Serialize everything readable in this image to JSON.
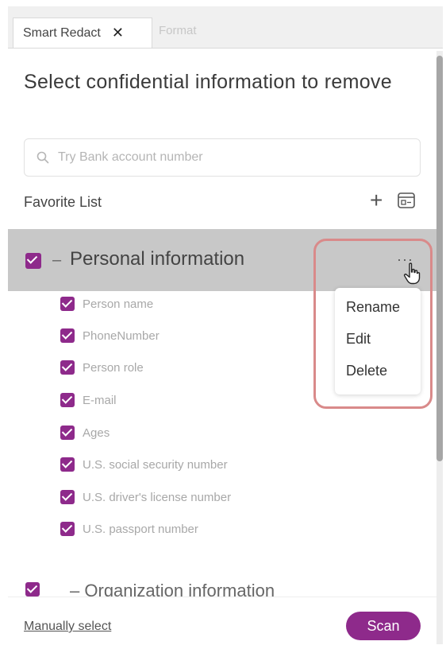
{
  "tabs": [
    {
      "label": "Smart Redact",
      "close_label": "✕"
    },
    {
      "label": "Format"
    }
  ],
  "title": "Select confidential information to remove",
  "search": {
    "placeholder": "Try Bank account number"
  },
  "favorite_list": {
    "label": "Favorite List",
    "add_label": "+"
  },
  "group": {
    "label": "Personal information",
    "dash": "–",
    "more_label": "···",
    "items": [
      {
        "label": "Person name"
      },
      {
        "label": "PhoneNumber"
      },
      {
        "label": "Person role"
      },
      {
        "label": "E-mail"
      },
      {
        "label": "Ages"
      },
      {
        "label": "U.S. social security number"
      },
      {
        "label": "U.S. driver's license number"
      },
      {
        "label": "U.S. passport number"
      }
    ]
  },
  "context_menu": {
    "items": [
      {
        "label": "Rename"
      },
      {
        "label": "Edit"
      },
      {
        "label": "Delete"
      }
    ]
  },
  "next_group": {
    "label": "Organization information",
    "dash": "–"
  },
  "footer": {
    "manual_select_label": "Manually select",
    "scan_label": "Scan"
  },
  "colors": {
    "accent": "#8e2a8b",
    "highlight_ring": "#d98a8a",
    "group_row_bg": "#c8c8c8"
  }
}
